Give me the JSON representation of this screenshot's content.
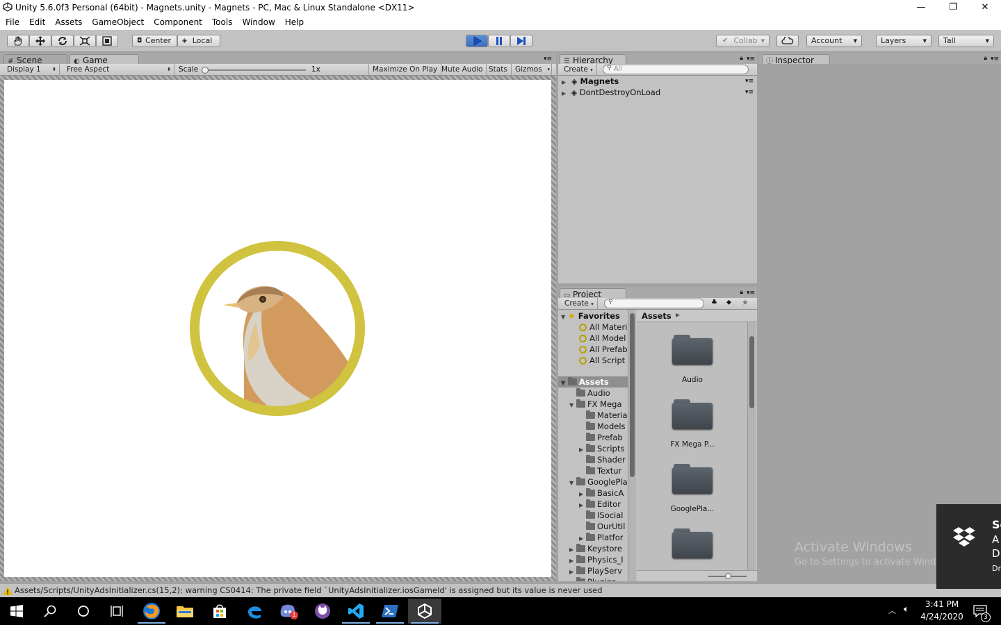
{
  "window": {
    "title": "Unity 5.6.0f3 Personal (64bit) - Magnets.unity - Magnets - PC, Mac & Linux Standalone <DX11>",
    "minimize": "—",
    "maximize": "❐",
    "close": "✕"
  },
  "menu": [
    "File",
    "Edit",
    "Assets",
    "GameObject",
    "Component",
    "Tools",
    "Window",
    "Help"
  ],
  "toolbar": {
    "pivot": "Center",
    "space": "Local",
    "collab": "Collab",
    "account": "Account",
    "layers": "Layers",
    "layout": "Tall"
  },
  "scene_tab": "Scene",
  "game_tab": "Game",
  "game": {
    "display": "Display 1",
    "aspect": "Free Aspect",
    "scale_label": "Scale",
    "scale_value": "1x",
    "maximize": "Maximize On Play",
    "mute": "Mute Audio",
    "stats": "Stats",
    "gizmos": "Gizmos"
  },
  "hierarchy": {
    "tab": "Hierarchy",
    "create": "Create",
    "search_placeholder": "All",
    "items": [
      "Magnets",
      "DontDestroyOnLoad"
    ]
  },
  "project": {
    "tab": "Project",
    "create": "Create",
    "favorites_label": "Favorites",
    "favorites": [
      "All Materi",
      "All Model",
      "All Prefab",
      "All Script"
    ],
    "assets_label": "Assets",
    "tree": [
      {
        "label": "Audio",
        "depth": 1,
        "expand": ""
      },
      {
        "label": "FX Mega",
        "depth": 1,
        "expand": "▼"
      },
      {
        "label": "Materia",
        "depth": 2,
        "expand": ""
      },
      {
        "label": "Models",
        "depth": 2,
        "expand": ""
      },
      {
        "label": "Prefab",
        "depth": 2,
        "expand": ""
      },
      {
        "label": "Scripts",
        "depth": 2,
        "expand": "▶"
      },
      {
        "label": "Shader",
        "depth": 2,
        "expand": ""
      },
      {
        "label": "Textur",
        "depth": 2,
        "expand": ""
      },
      {
        "label": "GooglePla",
        "depth": 1,
        "expand": "▼"
      },
      {
        "label": "BasicA",
        "depth": 2,
        "expand": "▶"
      },
      {
        "label": "Editor",
        "depth": 2,
        "expand": "▶"
      },
      {
        "label": "ISocial",
        "depth": 2,
        "expand": ""
      },
      {
        "label": "OurUtil",
        "depth": 2,
        "expand": ""
      },
      {
        "label": "Platfor",
        "depth": 2,
        "expand": "▶"
      },
      {
        "label": "Keystore",
        "depth": 1,
        "expand": "▶"
      },
      {
        "label": "Physics_I",
        "depth": 1,
        "expand": "▶"
      },
      {
        "label": "PlayServ",
        "depth": 1,
        "expand": "▶"
      },
      {
        "label": "Plugins",
        "depth": 1,
        "expand": "▶"
      }
    ],
    "breadcrumb": "Assets",
    "grid": [
      "Audio",
      "FX Mega P...",
      "GooglePla...",
      ""
    ]
  },
  "inspector": {
    "tab": "Inspector"
  },
  "console": {
    "message": "Assets/Scripts/UnityAdsInitializer.cs(15,2): warning CS0414: The private field `UnityAdsInitializer.iosGameId' is assigned but its value is never used"
  },
  "taskbar": {
    "time": "3:41 PM",
    "date": "4/24/2020",
    "notification_count": "3",
    "discord_badge": "1"
  },
  "watermark": {
    "line1": "Activate Windows",
    "line2": "Go to Settings to activate Windows."
  },
  "toast": {
    "line1": "Sc",
    "line2": "A",
    "line3": "D",
    "line4": "Dr"
  },
  "colors": {
    "ring": "#cfc33f",
    "bird_body": "#d39a5e",
    "bird_head": "#d7b383",
    "bird_crown": "#a77e55",
    "bird_belly": "#d9d2c6",
    "play_accent": "#3a6fc0"
  }
}
